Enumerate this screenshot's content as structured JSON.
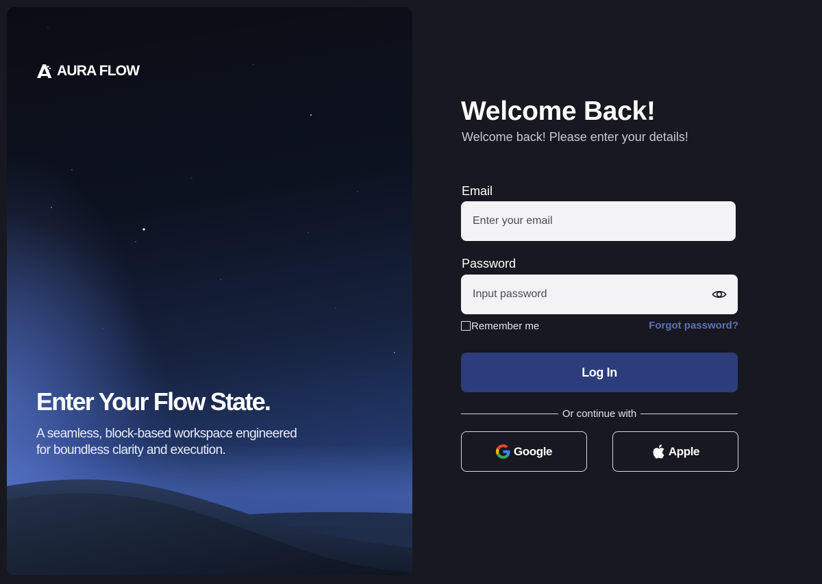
{
  "brand": {
    "name": "AURA FLOW",
    "icon": "aura-flow-logo-icon"
  },
  "hero": {
    "title": "Enter Your Flow State.",
    "subtitle_line1": "A seamless, block-based workspace engineered",
    "subtitle_line2": "for boundless clarity and execution."
  },
  "form": {
    "heading": "Welcome Back!",
    "subheading": "Welcome back! Please enter your details!",
    "email": {
      "label": "Email",
      "placeholder": "Enter your email",
      "value": ""
    },
    "password": {
      "label": "Password",
      "placeholder": "Input password",
      "value": "",
      "toggle_icon": "eye-icon"
    },
    "remember_label": "Remember me",
    "remember_checked": false,
    "forgot_label": "Forgot password?",
    "login_label": "Log In",
    "divider_text": "Or continue with",
    "google_label": "Google",
    "apple_label": "Apple"
  },
  "colors": {
    "background": "#181820",
    "primary_button": "#2b3d7a",
    "link": "#5c72b8",
    "input_bg": "#f3f3f5"
  }
}
